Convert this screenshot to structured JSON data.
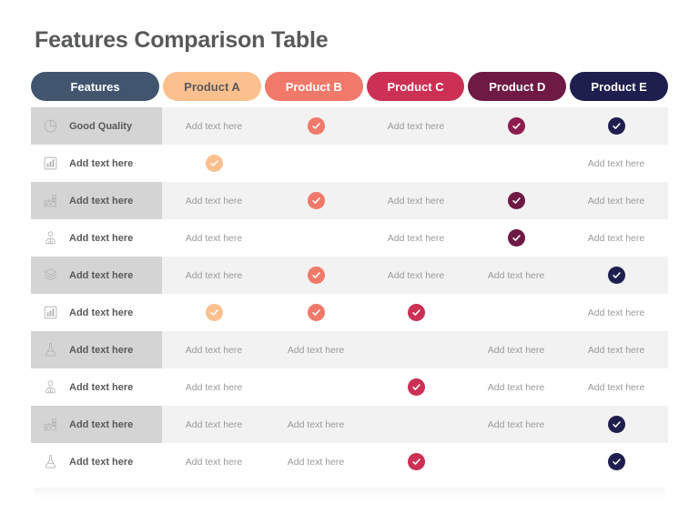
{
  "title": "Features Comparison Table",
  "colors": {
    "title": "#58595b",
    "feature_pill_bg": "#41566e",
    "feature_pill_text": "#ffffff",
    "product_a_bg": "#fcc08f",
    "product_a_text": "#58595b",
    "product_b_bg": "#f0796a",
    "product_b_text": "#ffffff",
    "product_c_bg": "#cc3055",
    "product_c_text": "#ffffff",
    "product_d_bg": "#6e1a44",
    "product_d_text": "#ffffff",
    "product_e_bg": "#1f1f4f",
    "product_e_text": "#ffffff",
    "row_shaded_bg": "#f2f2f2",
    "row_plain_bg": "#ffffff",
    "feature_cell_shaded_bg": "#d4d4d4",
    "cell_text": "#9a9a9a",
    "feature_label_text": "#58595b",
    "icon": "#b3b3b3"
  },
  "header": {
    "feature_label": "Features",
    "products": [
      {
        "label": "Product A",
        "key": "a"
      },
      {
        "label": "Product B",
        "key": "b"
      },
      {
        "label": "Product C",
        "key": "c"
      },
      {
        "label": "Product D",
        "key": "d"
      },
      {
        "label": "Product E",
        "key": "e"
      }
    ]
  },
  "placeholder_text": "Add text here",
  "rows": [
    {
      "icon": "pie-chart-icon",
      "label": "Good Quality",
      "shaded": true,
      "cells": [
        {
          "type": "text",
          "value": "Add text here"
        },
        {
          "type": "check",
          "color": "#f0796a"
        },
        {
          "type": "text",
          "value": "Add text here"
        },
        {
          "type": "check",
          "color": "#8c1d4d"
        },
        {
          "type": "check",
          "color": "#1f1f4f"
        }
      ]
    },
    {
      "icon": "bar-chart-icon",
      "label": "Add text here",
      "shaded": false,
      "cells": [
        {
          "type": "check",
          "color": "#fcc08f"
        },
        {
          "type": "empty"
        },
        {
          "type": "empty"
        },
        {
          "type": "empty"
        },
        {
          "type": "text",
          "value": "Add text here"
        }
      ]
    },
    {
      "icon": "factory-icon",
      "label": "Add text here",
      "shaded": true,
      "cells": [
        {
          "type": "text",
          "value": "Add text here"
        },
        {
          "type": "check",
          "color": "#f0796a"
        },
        {
          "type": "text",
          "value": "Add text here"
        },
        {
          "type": "check",
          "color": "#6e1a44"
        },
        {
          "type": "text",
          "value": "Add text here"
        }
      ]
    },
    {
      "icon": "businessman-icon",
      "label": "Add text here",
      "shaded": false,
      "cells": [
        {
          "type": "text",
          "value": "Add text here"
        },
        {
          "type": "empty"
        },
        {
          "type": "text",
          "value": "Add text here"
        },
        {
          "type": "check",
          "color": "#6e1a44"
        },
        {
          "type": "text",
          "value": "Add text here"
        }
      ]
    },
    {
      "icon": "open-box-icon",
      "label": "Add text here",
      "shaded": true,
      "cells": [
        {
          "type": "text",
          "value": "Add text here"
        },
        {
          "type": "check",
          "color": "#f0796a"
        },
        {
          "type": "text",
          "value": "Add text here"
        },
        {
          "type": "text",
          "value": "Add text here"
        },
        {
          "type": "check",
          "color": "#1f1f4f"
        }
      ]
    },
    {
      "icon": "bar-chart-icon",
      "label": "Add text here",
      "shaded": false,
      "cells": [
        {
          "type": "check",
          "color": "#fcc08f"
        },
        {
          "type": "check",
          "color": "#f0796a"
        },
        {
          "type": "check",
          "color": "#cc3055"
        },
        {
          "type": "empty"
        },
        {
          "type": "text",
          "value": "Add text here"
        }
      ]
    },
    {
      "icon": "flask-icon",
      "label": "Add text here",
      "shaded": true,
      "cells": [
        {
          "type": "text",
          "value": "Add text here"
        },
        {
          "type": "text",
          "value": "Add text here"
        },
        {
          "type": "empty"
        },
        {
          "type": "text",
          "value": "Add text here"
        },
        {
          "type": "text",
          "value": "Add text here"
        }
      ]
    },
    {
      "icon": "businessman-icon",
      "label": "Add text here",
      "shaded": false,
      "cells": [
        {
          "type": "text",
          "value": "Add text here"
        },
        {
          "type": "empty"
        },
        {
          "type": "check",
          "color": "#cc3055"
        },
        {
          "type": "text",
          "value": "Add text here"
        },
        {
          "type": "text",
          "value": "Add text here"
        }
      ]
    },
    {
      "icon": "factory-icon",
      "label": "Add text here",
      "shaded": true,
      "cells": [
        {
          "type": "text",
          "value": "Add text here"
        },
        {
          "type": "text",
          "value": "Add text here"
        },
        {
          "type": "empty"
        },
        {
          "type": "text",
          "value": "Add text here"
        },
        {
          "type": "check",
          "color": "#1f1f4f"
        }
      ]
    },
    {
      "icon": "flask-icon",
      "label": "Add text here",
      "shaded": false,
      "cells": [
        {
          "type": "text",
          "value": "Add text here"
        },
        {
          "type": "text",
          "value": "Add text here"
        },
        {
          "type": "check",
          "color": "#cc3055"
        },
        {
          "type": "empty"
        },
        {
          "type": "check",
          "color": "#1f1f4f"
        }
      ]
    }
  ]
}
